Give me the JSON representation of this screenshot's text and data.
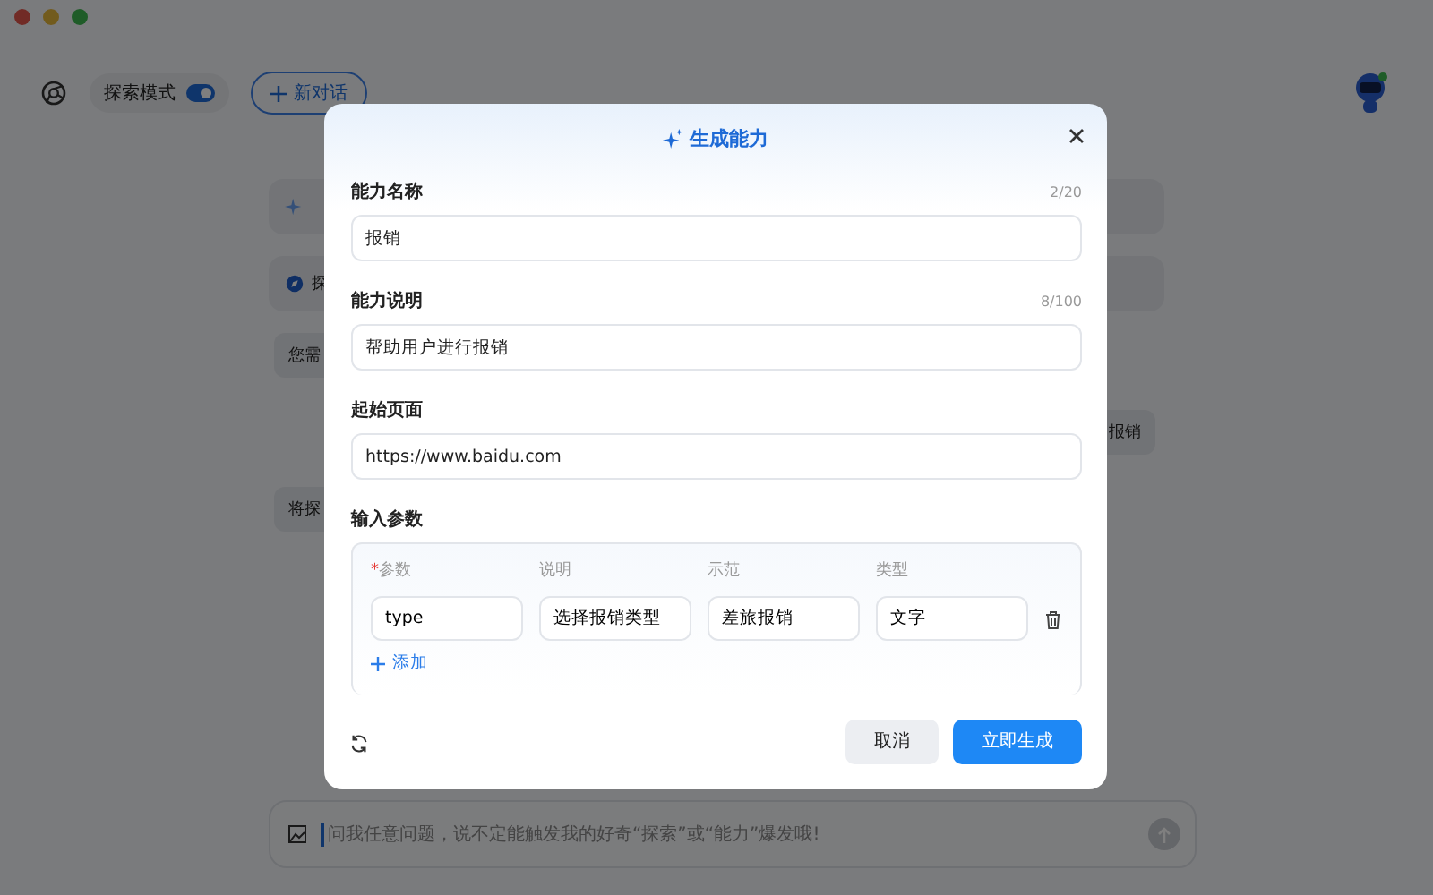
{
  "topbar": {
    "mode_toggle": {
      "label": "探索模式",
      "on": true
    },
    "new_chat_button": "新对话"
  },
  "cards": [
    {
      "kind": "sparkle"
    },
    {
      "kind": "explore",
      "text": "探"
    }
  ],
  "messages": [
    {
      "kind": "assistant",
      "text": "您需"
    },
    {
      "kind": "user",
      "text": "报销"
    },
    {
      "kind": "assistant",
      "text": "将探"
    }
  ],
  "chat_input": {
    "placeholder": "问我任意问题，说不定能触发我的好奇“探索”或“能力”爆发哦!"
  },
  "dialog": {
    "title": "生成能力",
    "fields": [
      {
        "label": "能力名称",
        "counter": "2/20",
        "value": "报销"
      },
      {
        "label": "能力说明",
        "counter": "8/100",
        "value": "帮助用户进行报销"
      },
      {
        "label": "起始页面",
        "value": "https://www.baidu.com"
      }
    ],
    "params": {
      "label": "输入参数",
      "columns": [
        {
          "label": "参数",
          "required_mark": "*"
        },
        {
          "label": "说明"
        },
        {
          "label": "示范"
        },
        {
          "label": "类型"
        }
      ],
      "rows": [
        {
          "values": [
            "type",
            "选择报销类型",
            "差旅报销",
            "文字"
          ]
        }
      ],
      "add_link": "添加"
    },
    "buttons": [
      {
        "label": "取消",
        "kind": "secondary"
      },
      {
        "label": "立即生成",
        "kind": "primary"
      }
    ]
  }
}
